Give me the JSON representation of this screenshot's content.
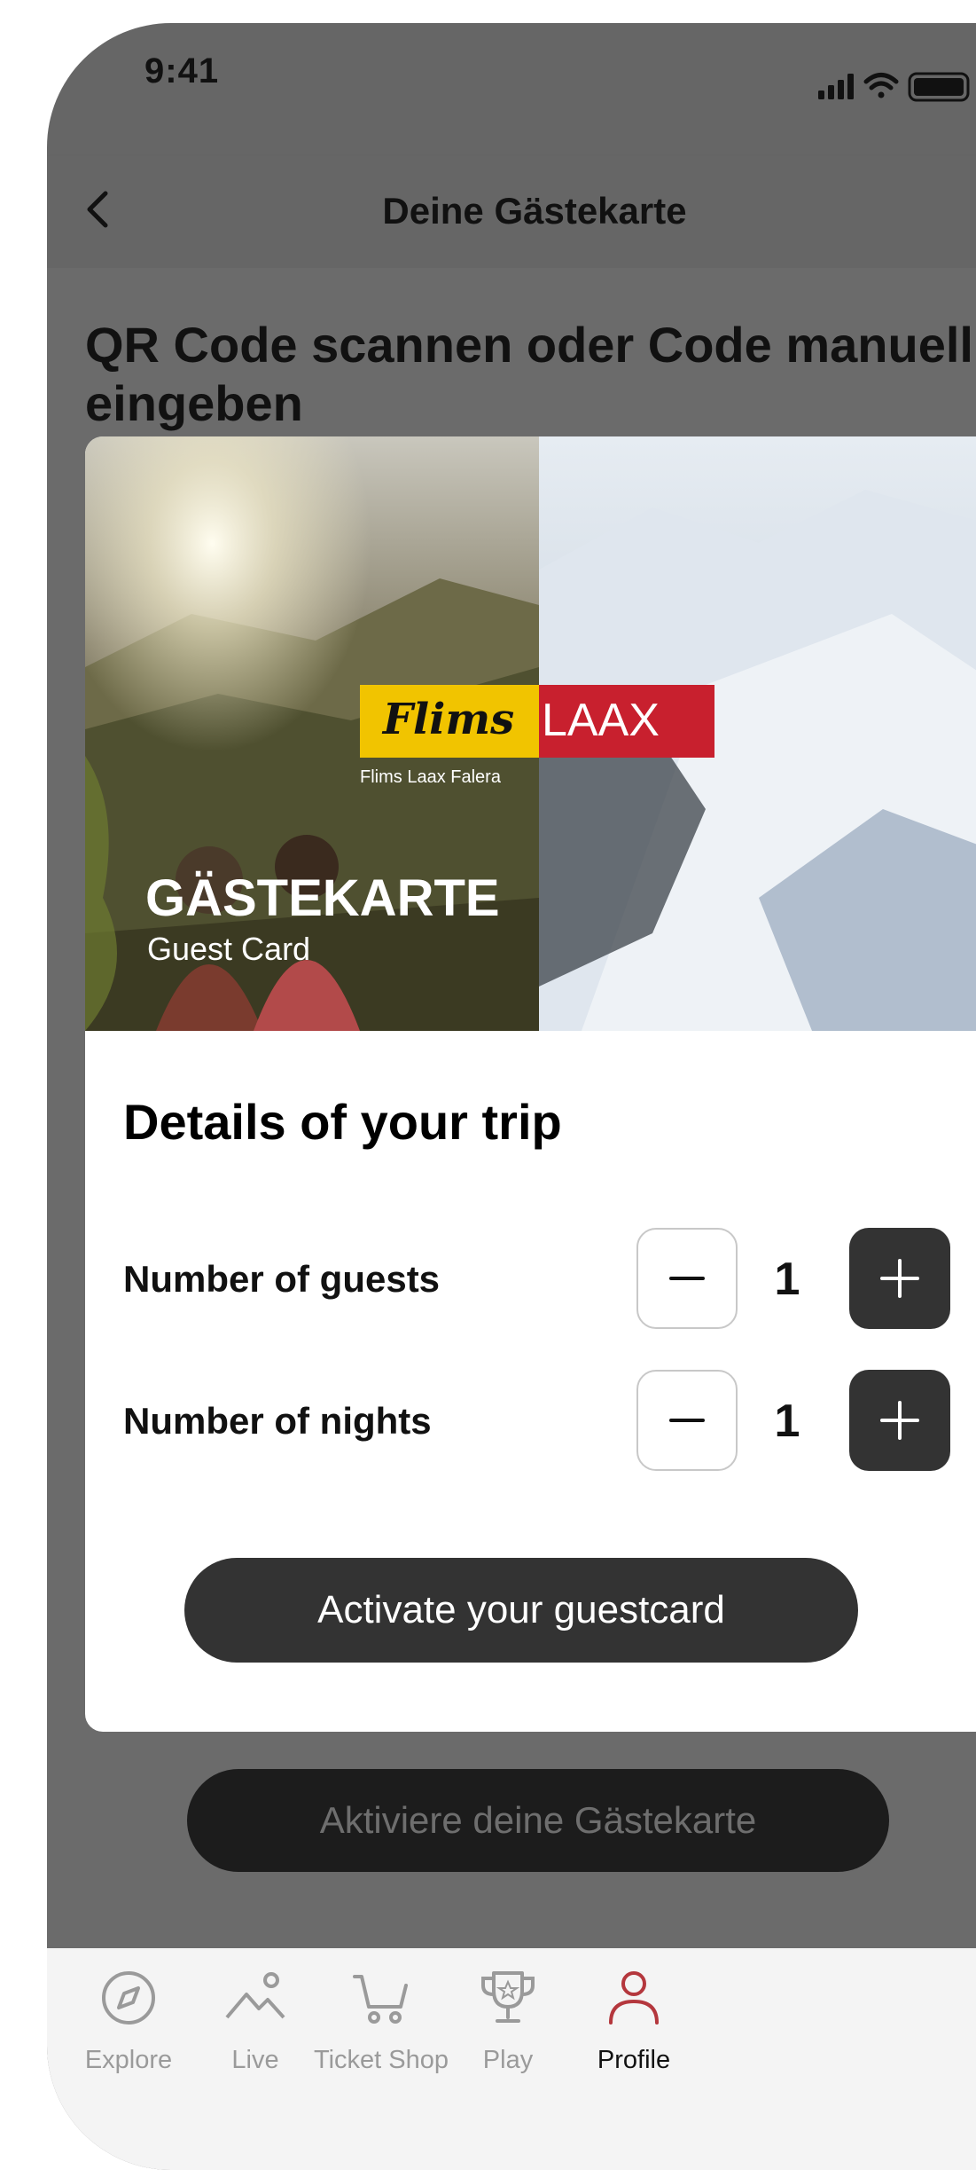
{
  "status_bar": {
    "time": "9:41"
  },
  "nav": {
    "title": "Deine Gästekarte"
  },
  "page": {
    "heading": "QR Code scannen oder Code manuell eingeben"
  },
  "card": {
    "logo_left": "Flims",
    "logo_right": "LAAX",
    "logo_sub": "Flims Laax Falera",
    "title": "GÄSTEKARTE",
    "subtitle": "Guest Card"
  },
  "modal": {
    "heading": "Details of your trip",
    "rows": [
      {
        "label": "Number of guests",
        "value": "1"
      },
      {
        "label": "Number of nights",
        "value": "1"
      }
    ],
    "activate_label": "Activate your guestcard"
  },
  "background_button": {
    "label": "Aktiviere deine Gästekarte"
  },
  "tabs": [
    {
      "label": "Explore",
      "icon": "compass-icon"
    },
    {
      "label": "Live",
      "icon": "mountain-icon"
    },
    {
      "label": "Ticket Shop",
      "icon": "cart-icon"
    },
    {
      "label": "Play",
      "icon": "trophy-icon"
    },
    {
      "label": "Profile",
      "icon": "person-icon",
      "active": true
    }
  ],
  "colors": {
    "overlay": "#666666",
    "dark_button": "#333333",
    "active_tab_icon": "#b4373d",
    "logo_yellow": "#f1c400",
    "logo_red": "#c8202e"
  }
}
